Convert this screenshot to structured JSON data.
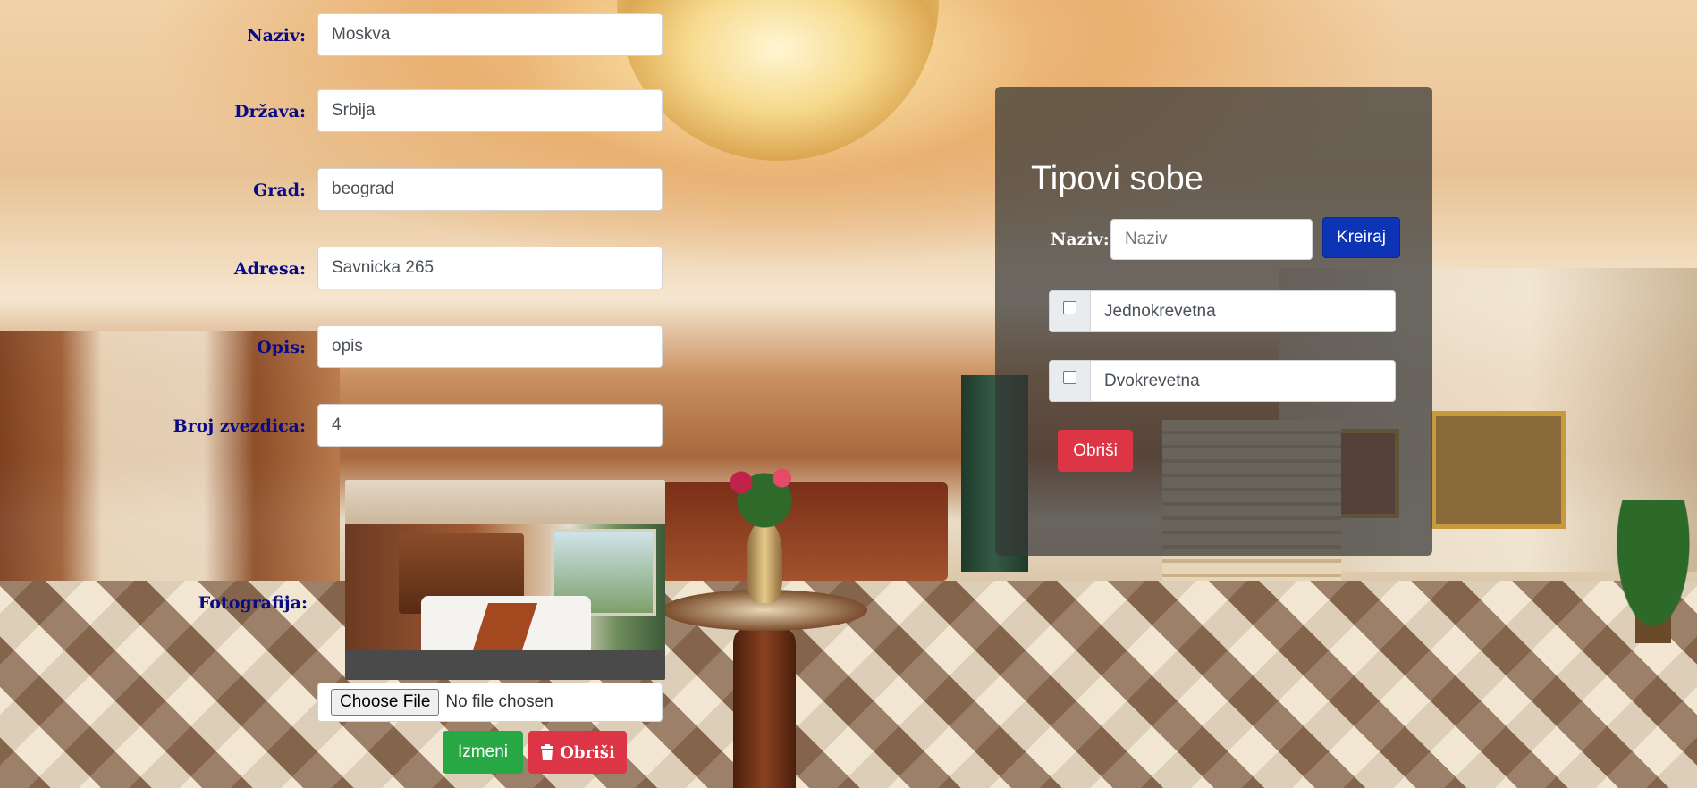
{
  "form": {
    "naziv": {
      "label": "Naziv:",
      "value": "Moskva"
    },
    "drzava": {
      "label": "Država:",
      "value": "Srbija"
    },
    "grad": {
      "label": "Grad:",
      "value": "beograd"
    },
    "adresa": {
      "label": "Adresa:",
      "value": "Savnicka 265"
    },
    "opis": {
      "label": "Opis:",
      "value": "opis"
    },
    "broj_zvezdica": {
      "label": "Broj zvezdica:",
      "value": "4"
    },
    "fotografija": {
      "label": "Fotografija:",
      "choose_file_label": "Choose File",
      "file_status": "No file chosen"
    },
    "izmeni_label": "Izmeni",
    "obrisi_label": "Obriši"
  },
  "tipovi_sobe": {
    "title": "Tipovi sobe",
    "naziv_label": "Naziv:",
    "naziv_placeholder": "Naziv",
    "kreiraj_label": "Kreiraj",
    "types": [
      {
        "name": "Jednokrevetna",
        "checked": false
      },
      {
        "name": "Dvokrevetna",
        "checked": false
      }
    ],
    "obrisi_label": "Obriši"
  },
  "colors": {
    "label_text": "#0a0a85",
    "success": "#28a745",
    "danger": "#dc3545",
    "primary": "#0d34b5",
    "panel_bg": "rgba(55,55,55,0.72)"
  }
}
